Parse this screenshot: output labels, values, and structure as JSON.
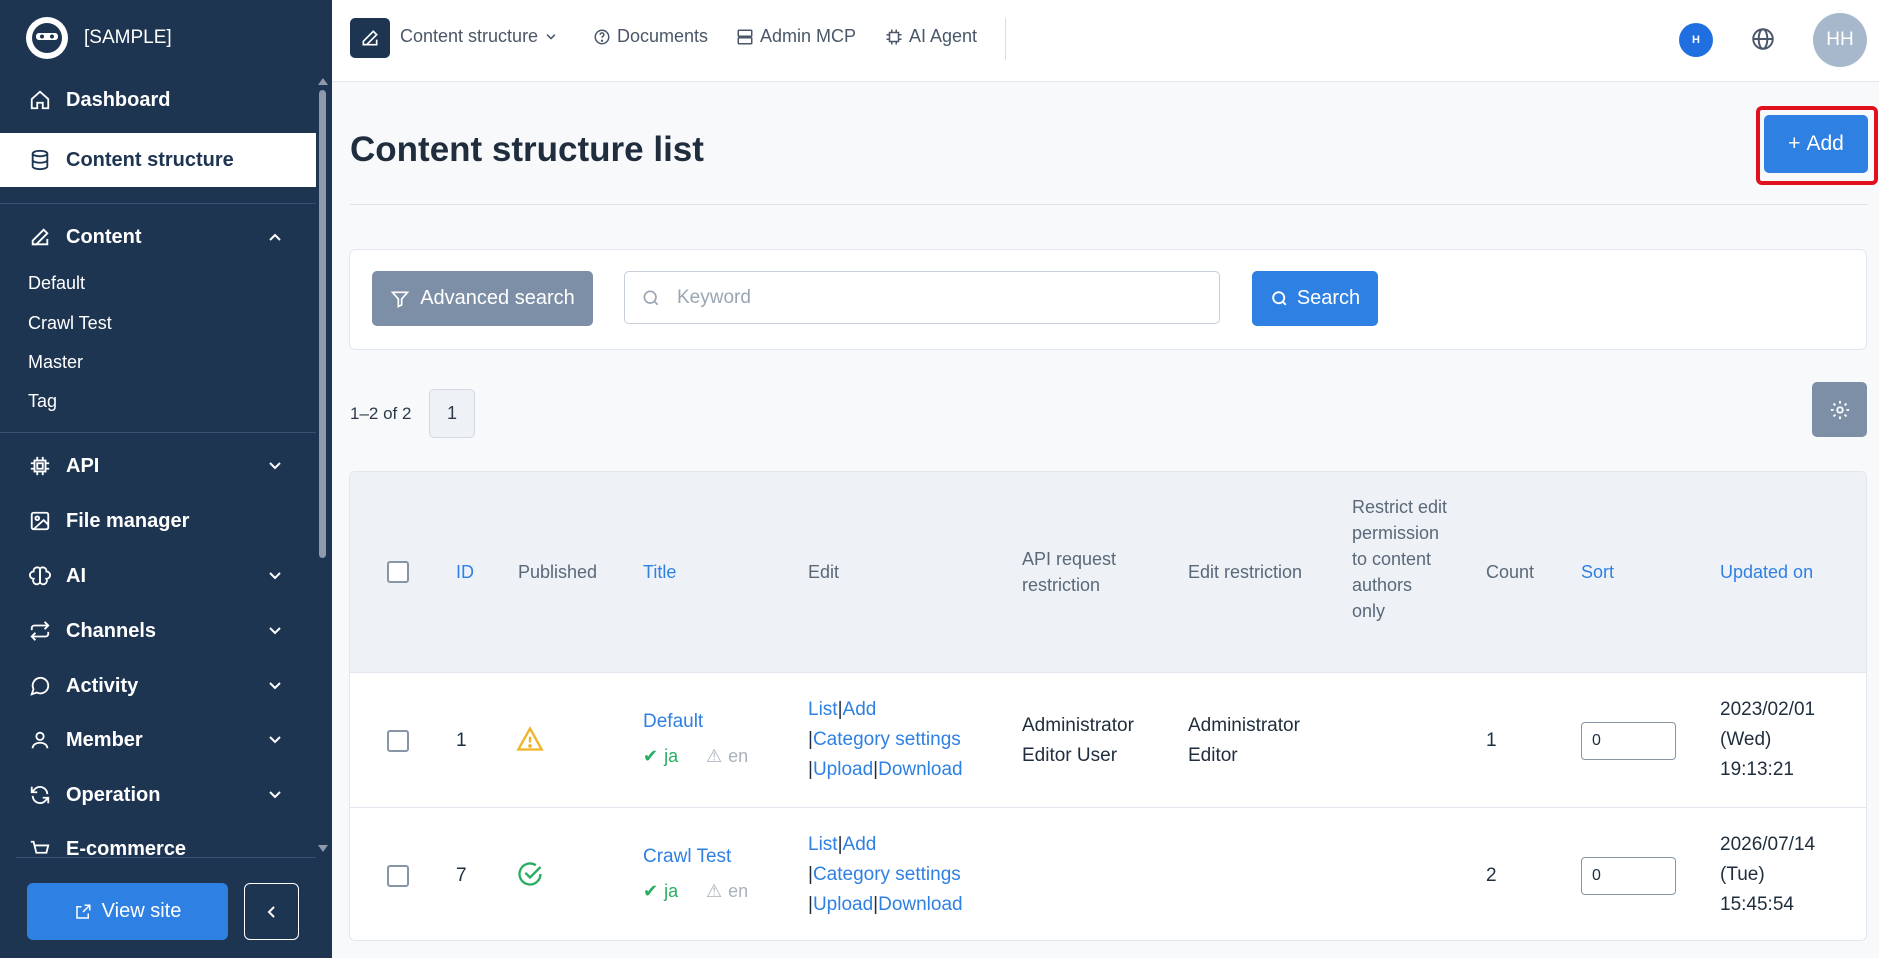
{
  "brand": {
    "name": "[SAMPLE]"
  },
  "sidebar": {
    "items": [
      {
        "label": "Dashboard",
        "icon": "home-icon"
      },
      {
        "label": "Content structure",
        "icon": "database-icon"
      },
      {
        "label": "Content",
        "icon": "edit-icon"
      },
      {
        "label": "API",
        "icon": "chip-icon"
      },
      {
        "label": "File manager",
        "icon": "image-icon"
      },
      {
        "label": "AI",
        "icon": "brain-icon"
      },
      {
        "label": "Channels",
        "icon": "channels-icon"
      },
      {
        "label": "Activity",
        "icon": "chat-icon"
      },
      {
        "label": "Member",
        "icon": "user-icon"
      },
      {
        "label": "Operation",
        "icon": "refresh-icon"
      },
      {
        "label": "E-commerce",
        "icon": "cart-icon"
      }
    ],
    "content_sub": [
      "Default",
      "Crawl Test",
      "Master",
      "Tag"
    ],
    "view_site": "View site"
  },
  "topbar": {
    "content_structure": "Content structure",
    "documents": "Documents",
    "admin_mcp": "Admin MCP",
    "ai_agent": "AI Agent",
    "avatar_small": "H",
    "avatar_large": "HH"
  },
  "main": {
    "title": "Content structure list",
    "add_label": "Add",
    "advanced_search": "Advanced search",
    "keyword_placeholder": "Keyword",
    "search_label": "Search",
    "count": "1–2 of 2",
    "page": "1"
  },
  "table": {
    "headers": {
      "id": "ID",
      "published": "Published",
      "title": "Title",
      "edit": "Edit",
      "api_request_restriction": "API request restriction",
      "edit_restriction": "Edit restriction",
      "restrict_edit": "Restrict edit permission to content authors only",
      "count": "Count",
      "sort": "Sort",
      "updated_on": "Updated on"
    },
    "rows": [
      {
        "id": "1",
        "published_status": "warning",
        "title": "Default",
        "lang_ja": "ja",
        "lang_en": "en",
        "edit_list": "List",
        "edit_add": "Add",
        "edit_category": "Category settings",
        "edit_upload": "Upload",
        "edit_download": "Download",
        "api_restriction": "Administrator Editor User",
        "edit_restriction": "Administrator Editor",
        "count": "1",
        "sort": "0",
        "updated_date": "2023/02/01",
        "updated_day": "(Wed)",
        "updated_time": "19:13:21"
      },
      {
        "id": "7",
        "published_status": "published",
        "title": "Crawl Test",
        "lang_ja": "ja",
        "lang_en": "en",
        "edit_list": "List",
        "edit_add": "Add",
        "edit_category": "Category settings",
        "edit_upload": "Upload",
        "edit_download": "Download",
        "api_restriction": "",
        "edit_restriction": "",
        "count": "2",
        "sort": "0",
        "updated_date": "2026/07/14",
        "updated_day": "(Tue)",
        "updated_time": "15:45:54"
      }
    ]
  },
  "colors": {
    "sidebar_bg": "#1e3552",
    "primary": "#2f80e3",
    "highlight": "#e0101f",
    "success": "#27ae60",
    "warning": "#f0b429"
  }
}
